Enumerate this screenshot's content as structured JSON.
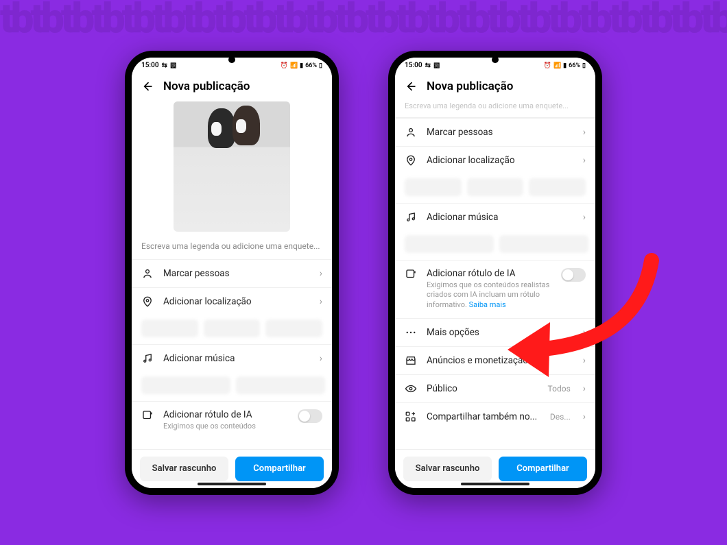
{
  "status_bar": {
    "time": "15:00",
    "battery": "66%"
  },
  "header": {
    "title": "Nova publicação"
  },
  "caption_placeholder": "Escreva uma legenda ou adicione uma enquete...",
  "rows": {
    "tag_people": "Marcar pessoas",
    "add_location": "Adicionar localização",
    "add_music": "Adicionar música",
    "ai_label_title": "Adicionar rótulo de IA",
    "ai_label_sub_short": "Exigimos que os conteúdos",
    "ai_label_sub_full": "Exigimos que os conteúdos realistas criados com IA incluam um rótulo informativo. ",
    "ai_label_link": "Saiba mais",
    "more_options": "Mais opções",
    "ads": "Anúncios e monetização",
    "audience": "Público",
    "audience_value": "Todos",
    "share_also": "Compartilhar também no...",
    "share_also_value": "Des..."
  },
  "footer": {
    "draft_label": "Salvar rascunho",
    "share_label": "Compartilhar"
  }
}
